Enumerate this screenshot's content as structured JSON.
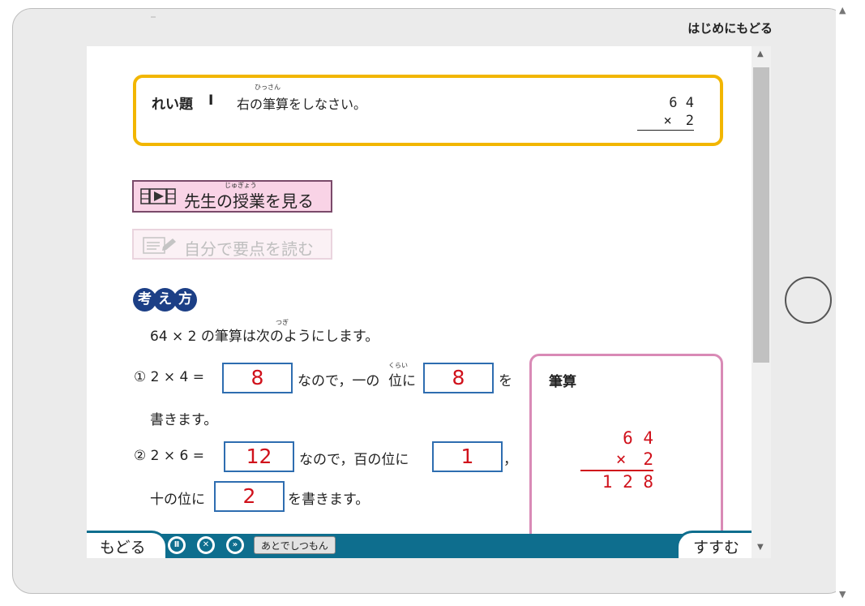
{
  "header": {
    "home_link": "はじめにもどる"
  },
  "example": {
    "label": "れい題",
    "number": "Ⅰ",
    "text": "右の筆算をしなさい。",
    "ruby": "ひっさん",
    "calc": {
      "top": "6 4",
      "bottom": "×　2"
    }
  },
  "buttons": {
    "lesson": "先生の授業を見る",
    "lesson_ruby": "じゅぎょう",
    "points": "自分で要点を読む"
  },
  "thinking": {
    "badge": [
      "考",
      "え",
      "方"
    ],
    "intro": "64 × 2 の筆算は次のようにします。",
    "intro_ruby": "つぎ",
    "step1": {
      "prefix": "① 2 × 4 =",
      "answer1": "8",
      "middle": "なので，一の",
      "middle2": "位に",
      "ruby": "くらい",
      "answer2": "8",
      "suffix": "を",
      "cont": "書きます。"
    },
    "step2": {
      "prefix": "② 2 × 6 =",
      "answer1": "12",
      "middle": "なので，百の位に",
      "answer2": "1",
      "suffix": "，",
      "cont_prefix": "十の位に",
      "answer3": "2",
      "cont_suffix": "を書きます。"
    }
  },
  "hissan": {
    "title": "筆算",
    "rows": [
      "6 4",
      "×　2",
      "1 2 8"
    ]
  },
  "footer": {
    "back": "もどる",
    "next": "すすむ",
    "later": "あとでしつもん",
    "controls": [
      "Ⅱ",
      "✕",
      "»"
    ]
  }
}
